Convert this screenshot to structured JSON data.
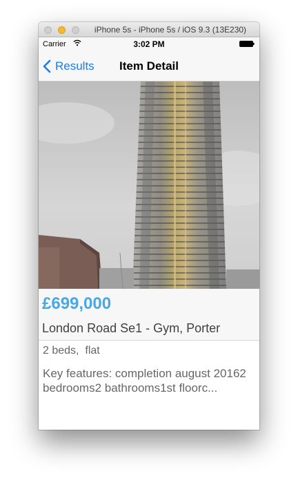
{
  "window": {
    "title": "iPhone 5s - iPhone 5s / iOS 9.3 (13E230)"
  },
  "status_bar": {
    "carrier": "Carrier",
    "time": "3:02 PM"
  },
  "nav_bar": {
    "back_label": "Results",
    "title": "Item Detail"
  },
  "listing": {
    "price": "£699,000",
    "title": "London Road Se1 - Gym, Porter",
    "beds_type": "2 beds,  flat",
    "summary": "Key features: completion august 20162 bedrooms2 bathrooms1st floorc..."
  },
  "colors": {
    "tint": "#1a7cf5",
    "price": "#4aa8e0",
    "traffic_min": "#f5b82e"
  }
}
